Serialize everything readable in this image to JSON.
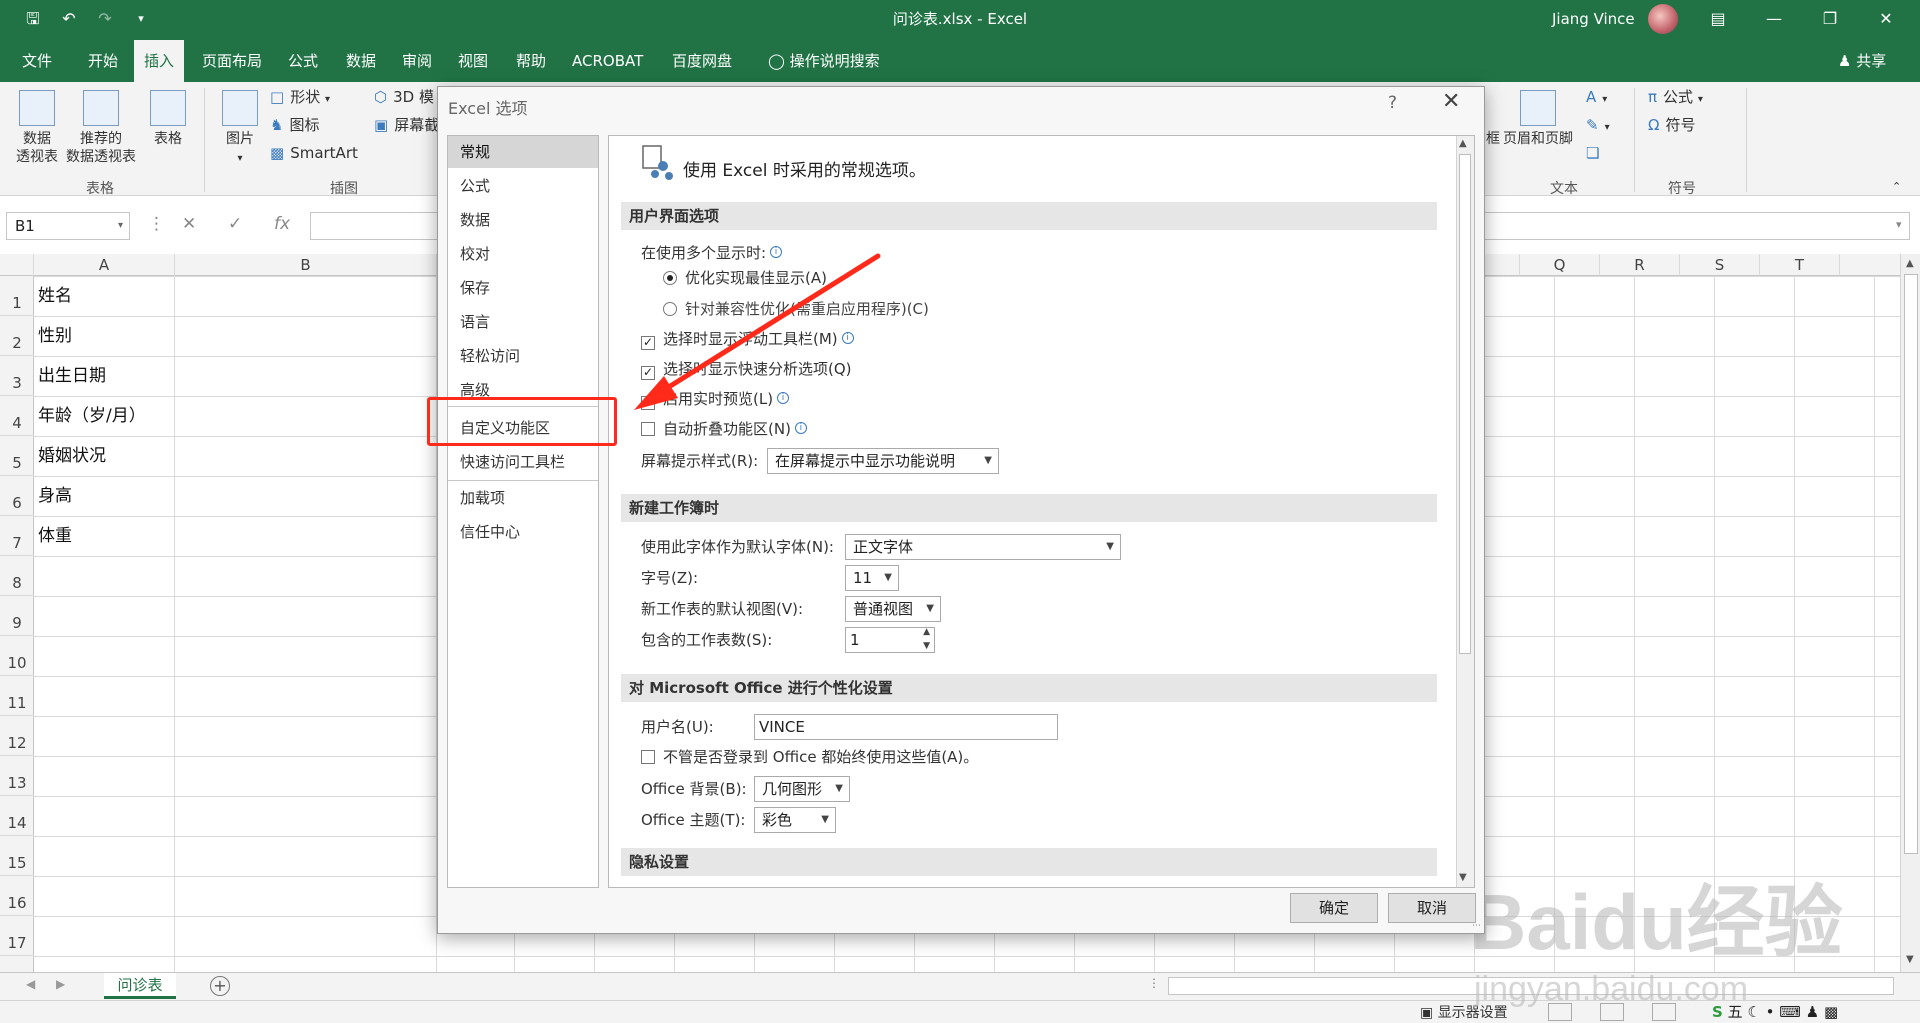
{
  "titlebar": {
    "title": "问诊表.xlsx - Excel",
    "user": "Jiang Vince",
    "qat": [
      "save-icon",
      "undo-icon",
      "redo-icon",
      "customize-icon"
    ],
    "accent": "#217346"
  },
  "tabs": [
    "文件",
    "开始",
    "插入",
    "页面布局",
    "公式",
    "数据",
    "审阅",
    "视图",
    "帮助",
    "ACROBAT",
    "百度网盘",
    "操作说明搜索"
  ],
  "active_tab": "插入",
  "share_label": "共享",
  "ribbon": {
    "pivot": "数据\n透视表",
    "pivot_l1": "数据",
    "pivot_l2": "透视表",
    "rec_l1": "推荐的",
    "rec_l2": "数据透视表",
    "table": "表格",
    "picture": "图片",
    "shapes": "形状",
    "icons": "图标",
    "smartart": "SmartArt",
    "model3d": "3D 模",
    "screenshot": "屏幕截",
    "group_table": "表格",
    "group_illus": "插图",
    "header_footer": "页眉和页脚",
    "group_text": "文本",
    "equation": "公式",
    "symbol": "符号",
    "group_symbol": "符号",
    "box_suffix": "框"
  },
  "formula": {
    "namebox": "B1"
  },
  "columns": [
    "A",
    "B",
    "P",
    "Q",
    "R",
    "S",
    "T"
  ],
  "rows": [
    "1",
    "2",
    "3",
    "4",
    "5",
    "6",
    "7",
    "8",
    "9",
    "10",
    "11",
    "12",
    "13",
    "14",
    "15",
    "16",
    "17"
  ],
  "cells_a": [
    "姓名",
    "性别",
    "出生日期",
    "年龄（岁/月）",
    "婚姻状况",
    "身高",
    "体重"
  ],
  "sheet_tab": "问诊表",
  "status": {
    "display_settings": "显示器设置",
    "ime": "五"
  },
  "dialog": {
    "title": "Excel 选项",
    "nav": [
      "常规",
      "公式",
      "数据",
      "校对",
      "保存",
      "语言",
      "轻松访问",
      "高级",
      "自定义功能区",
      "快速访问工具栏",
      "加载项",
      "信任中心"
    ],
    "intro": "使用 Excel 时采用的常规选项。",
    "sec_ui": "用户界面选项",
    "multi_display": "在使用多个显示时:",
    "opt_best": "优化实现最佳显示(A)",
    "opt_compat": "针对兼容性优化(需重启应用程序)(C)",
    "mini_toolbar": "选择时显示浮动工具栏(M)",
    "quick_analysis": "选择时显示快速分析选项(Q)",
    "live_preview": "启用实时预览(L)",
    "auto_collapse": "自动折叠功能区(N)",
    "tooltip_style": "屏幕提示样式(R):",
    "tooltip_value": "在屏幕提示中显示功能说明",
    "sec_new": "新建工作簿时",
    "font_label": "使用此字体作为默认字体(N):",
    "font_value": "正文字体",
    "size_label": "字号(Z):",
    "size_value": "11",
    "view_label": "新工作表的默认视图(V):",
    "view_value": "普通视图",
    "sheets_label": "包含的工作表数(S):",
    "sheets_value": "1",
    "sec_office": "对 Microsoft Office 进行个性化设置",
    "username_label": "用户名(U):",
    "username_value": "VINCE",
    "always_use": "不管是否登录到 Office 都始终使用这些值(A)。",
    "bg_label": "Office 背景(B):",
    "bg_value": "几何图形",
    "theme_label": "Office 主题(T):",
    "theme_value": "彩色",
    "sec_privacy": "隐私设置",
    "ok": "确定",
    "cancel": "取消"
  },
  "watermark": {
    "brand": "Baidu经验",
    "url": "jingyan.baidu.com"
  },
  "highlight_color": "#ff2a1a"
}
